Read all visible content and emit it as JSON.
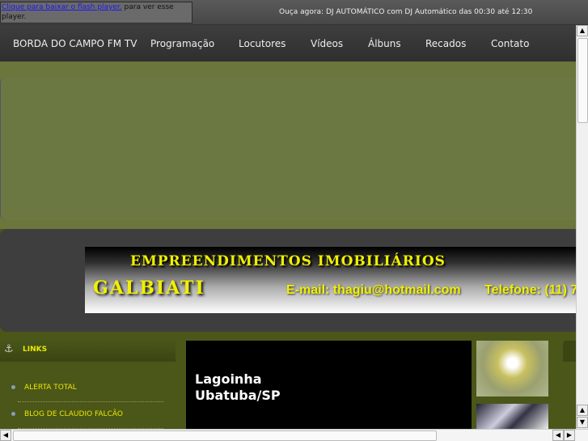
{
  "topbar": {
    "flash_link": "Clique para baixar o flash player.",
    "flash_rest": " para ver esse player.",
    "now_playing": "Ouça agora: DJ AUTOMÁTICO com DJ Automático das 00:30 até 12:30"
  },
  "nav": [
    {
      "label": "BORDA DO CAMPO FM TV"
    },
    {
      "label": "Programação"
    },
    {
      "label": "Locutores"
    },
    {
      "label": "Vídeos"
    },
    {
      "label": "Álbuns"
    },
    {
      "label": "Recados"
    },
    {
      "label": "Contato"
    }
  ],
  "banner": {
    "line1": "EMPREENDIMENTOS IMOBILIÁRIOS",
    "name": "GALBIATI",
    "email": "E-mail: thagiu@hotmail.com",
    "phone": "Telefone: (11) 7"
  },
  "links": {
    "title": "LINKS",
    "items": [
      {
        "label": "ALERTA TOTAL"
      },
      {
        "label": "BLOG DE CLAUDIO FALCÃO"
      }
    ]
  },
  "feature": {
    "line1": "Lagoinha",
    "line2": "Ubatuba/SP"
  }
}
